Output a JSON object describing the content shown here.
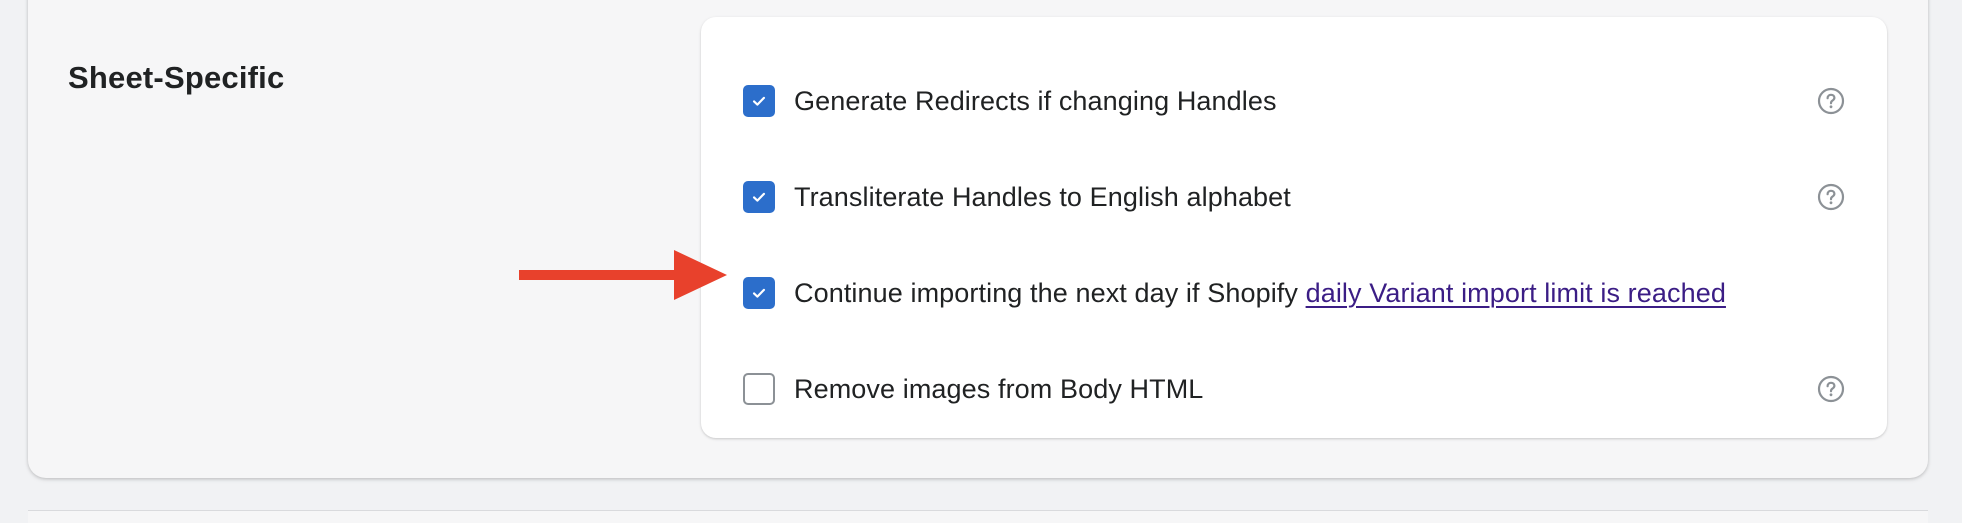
{
  "section": {
    "title": "Sheet-Specific"
  },
  "options": [
    {
      "label": "Generate Redirects if changing Handles",
      "checked": true,
      "help_icon": "question-circle-icon"
    },
    {
      "label": "Transliterate Handles to English alphabet",
      "checked": true,
      "help_icon": "question-circle-icon"
    },
    {
      "label": "Continue importing the next day if Shopify ",
      "link_text": "daily Variant import limit is reached",
      "checked": true
    },
    {
      "label": "Remove images from Body HTML",
      "checked": false,
      "help_icon": "question-circle-icon"
    }
  ],
  "annotation": {
    "icon": "red-arrow-pointer",
    "color": "#e8412c"
  },
  "colors": {
    "checkbox_accent": "#2c6ecb",
    "link": "#3b1d85",
    "background": "#f6f6f7"
  }
}
